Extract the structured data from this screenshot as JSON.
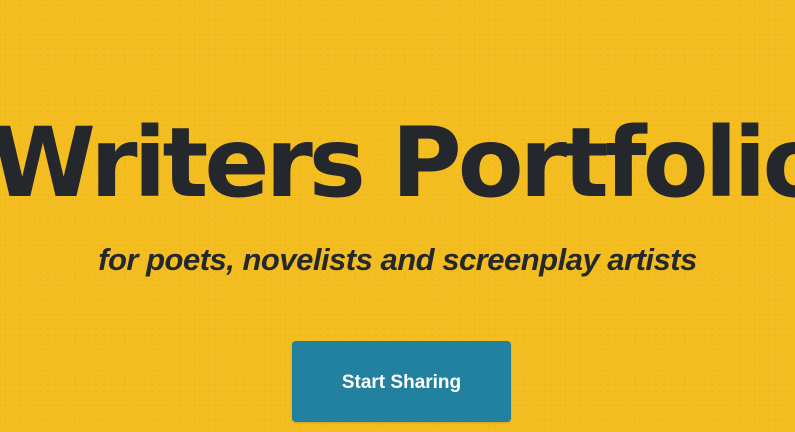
{
  "hero": {
    "title": "Writers Portfolio",
    "subtitle": "for poets, novelists and screenplay artists",
    "cta_label": "Start Sharing"
  },
  "colors": {
    "background": "#f4bd1f",
    "text": "#24272b",
    "button": "#22819f",
    "button_text": "#ffffff"
  }
}
